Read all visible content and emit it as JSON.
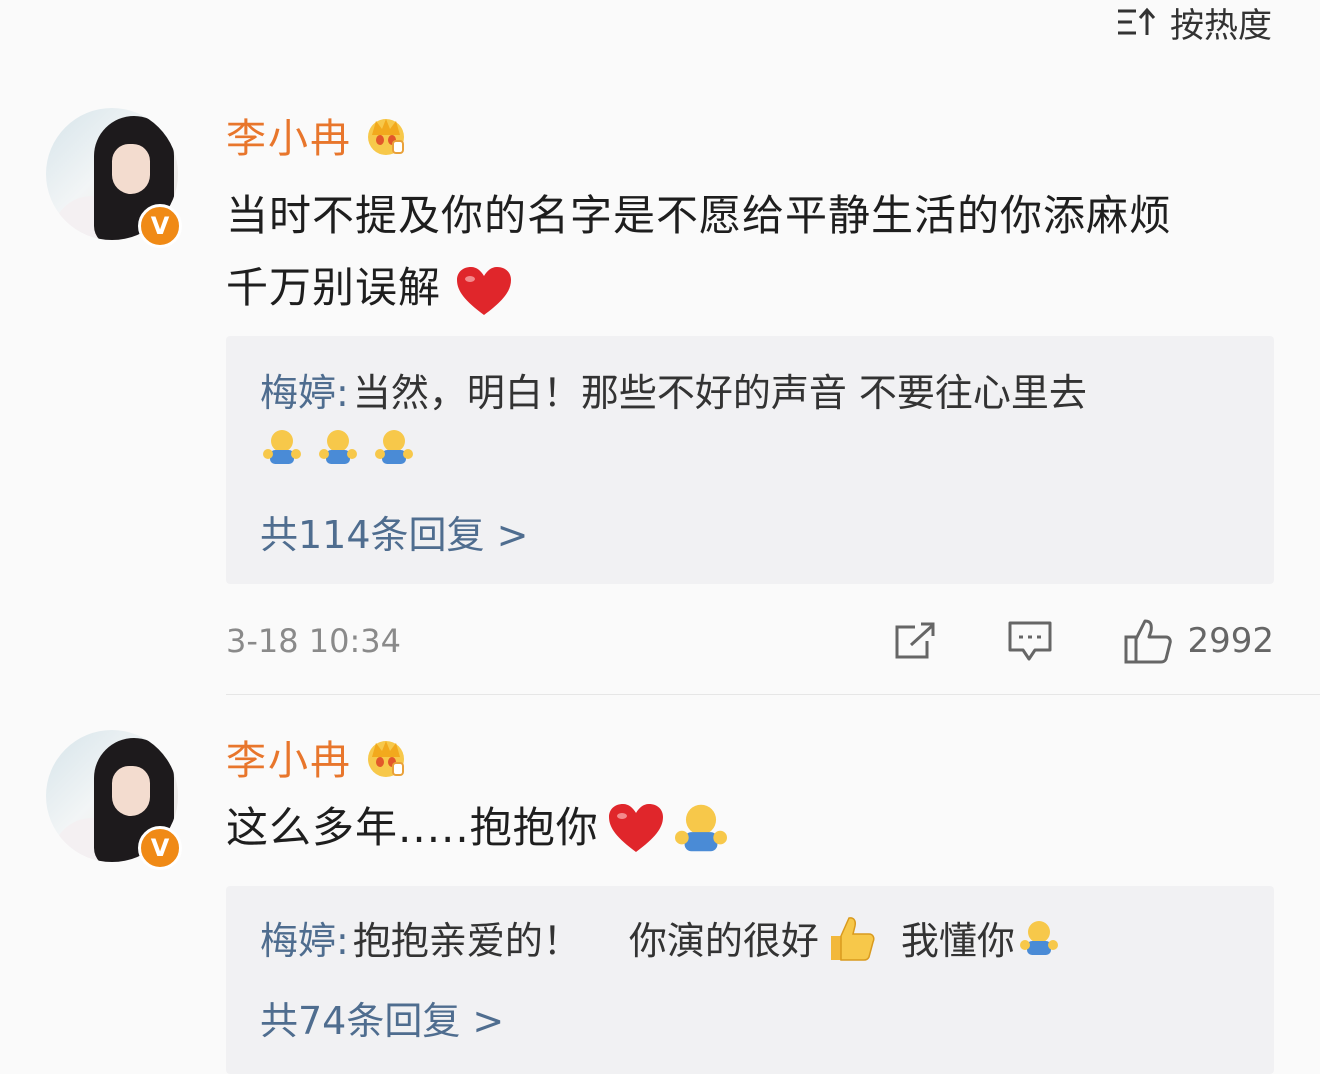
{
  "sort": {
    "label": "按热度"
  },
  "comments": [
    {
      "author": "李小冉",
      "text_line1": "当时不提及你的名字是不愿给平静生活的你添麻烦",
      "text_line2": "千万别误解",
      "reply": {
        "author": "梅婷:",
        "text": "当然，明白！那些不好的声音 不要往心里去"
      },
      "reply_count": "共114条回复 >",
      "time": "3-18 10:34",
      "likes": "2992"
    },
    {
      "author": "李小冉",
      "text": "这么多年.....抱抱你",
      "reply": {
        "author": "梅婷:",
        "text_a": "抱抱亲爱的！",
        "text_b": "你演的很好",
        "text_c": "我懂你"
      },
      "reply_count": "共74条回复 >"
    }
  ],
  "icons": {
    "sort": "sort-icon",
    "crown": "crown-badge-icon",
    "verified": "verified-v-icon",
    "heart": "red-heart-emoji",
    "hug": "hug-emoji",
    "thumbs": "thumbs-up-emoji",
    "share": "share-icon",
    "comment": "comment-icon",
    "like": "like-icon"
  },
  "colors": {
    "author": "#e8762c",
    "reply_author": "#4f6d8f",
    "verified": "#f08a16",
    "heart": "#e0262b"
  }
}
